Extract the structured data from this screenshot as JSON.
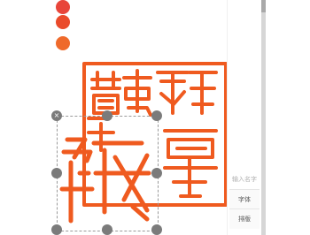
{
  "palette": {
    "swatches": [
      {
        "name": "red",
        "color": "#e8453a"
      },
      {
        "name": "orange-red",
        "color": "#ea4a2a"
      },
      {
        "name": "orange",
        "color": "#ef6a2b"
      }
    ]
  },
  "accent_color": "#ef5a1f",
  "sidebar": {
    "input_placeholder": "输入名字",
    "font_button": "字体",
    "layout_button": "排版"
  },
  "handles": {
    "close": "×",
    "rotate": "⟳",
    "resize_h": "‹›",
    "resize_v": "⌄"
  }
}
